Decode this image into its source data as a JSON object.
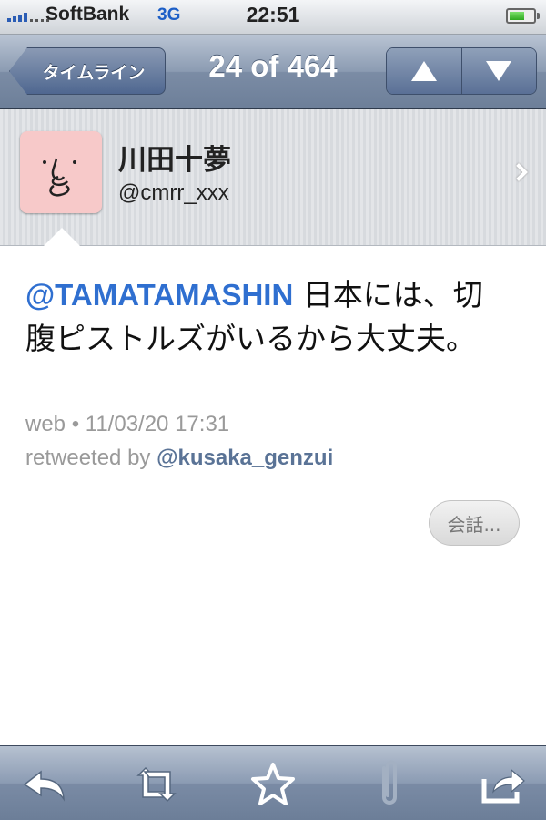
{
  "status_bar": {
    "carrier": "SoftBank",
    "network": "3G",
    "time": "22:51",
    "signal_bars": 4,
    "battery_level": 0.62
  },
  "nav_bar": {
    "back_label": "タイムライン",
    "title": "24 of 464",
    "up_icon": "arrow-up-icon",
    "down_icon": "arrow-down-icon"
  },
  "user": {
    "name": "川田十夢",
    "handle": "@cmrr_xxx",
    "avatar_icon": "face-avatar",
    "avatar_color": "#f7c9c9"
  },
  "tweet": {
    "mention": "@TAMATAMASHIN",
    "text": " 日本には、切腹ピストルズがいるから大丈夫。",
    "meta": "web • 11/03/20 17:31",
    "retweeted_prefix": "retweeted by ",
    "retweeted_user": "@kusaka_genzui",
    "conversation_label": "会話..."
  },
  "toolbar": {
    "items": [
      "reply-icon",
      "retweet-icon",
      "favorite-star-icon",
      "attach-paperclip-icon",
      "share-icon"
    ]
  },
  "colors": {
    "mention": "#2f6fd0",
    "meta_gray": "#9a9a9a",
    "nav_blue": "#6d7f99"
  }
}
